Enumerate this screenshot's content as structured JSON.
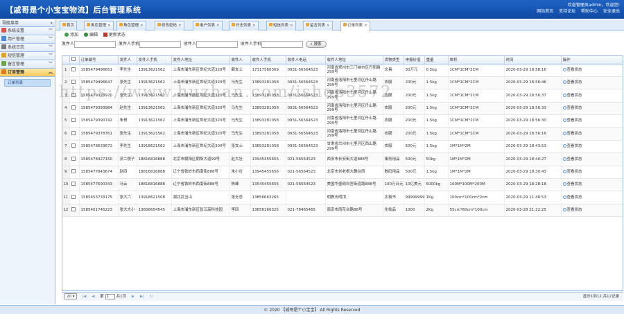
{
  "header": {
    "title": "【戚哥是个小宝宝物流】后台管理系统",
    "welcome": "欢迎管理员admin，欢迎您!",
    "links": [
      "网站首页",
      "支持论坛",
      "帮助中心",
      "安全退出"
    ]
  },
  "sidebar": {
    "title": "导航菜单",
    "collapse": "«",
    "items": [
      {
        "label": "系统设置",
        "icon_color": "#d9534f"
      },
      {
        "label": "用户管理",
        "icon_color": "#4a86d8"
      },
      {
        "label": "系统日志",
        "icon_color": "#7a7a7a"
      },
      {
        "label": "短信管理",
        "icon_color": "#e0a030"
      },
      {
        "label": "留言管理",
        "icon_color": "#6aa84f"
      },
      {
        "label": "订单管理",
        "icon_color": "#e07b20"
      }
    ],
    "sub_item": "订单列表"
  },
  "tabs": [
    {
      "label": "首页"
    },
    {
      "label": "角色管理"
    },
    {
      "label": "角色管理"
    },
    {
      "label": "修改密码"
    },
    {
      "label": "用户列表"
    },
    {
      "label": "日志列表"
    },
    {
      "label": "短信列表"
    },
    {
      "label": "留言列表"
    },
    {
      "label": "订单列表"
    }
  ],
  "tab_close": "×",
  "toolbar": {
    "add": "添加",
    "edit": "编辑",
    "status": "更新状态"
  },
  "search": {
    "sender": "发件人",
    "sender_phone": "发件人手机",
    "receiver": "收件人",
    "receiver_phone": "收件人手机",
    "button": "搜索"
  },
  "columns": [
    "订单编号",
    "发件人",
    "发件人手机",
    "发件人地址",
    "收件人",
    "收件人手机",
    "收件人电话",
    "收件人地址",
    "货物类型",
    "申报价值",
    "重量",
    "体积",
    "时间",
    "操作"
  ],
  "action_label": "查看状态",
  "rows": [
    [
      "1585479496651",
      "李先生",
      "13913621562",
      "上海市浦东新区世纪大道320号",
      "薛女士",
      "17317560369",
      "0931-56564523",
      "河南省郑州市三门峡市区丹阳路299号",
      "文具",
      "30万元",
      "0.5kg",
      "1CM*1CM*2CM",
      "2020-03-29 18:58:16"
    ],
    [
      "1585479496647",
      "张先生",
      "13913621562",
      "上海市浦东新区世纪大道320号",
      "马先生",
      "13893281058",
      "0931-56564523",
      "河南省洛阳市七里河区丹山路299号",
      "衣服",
      "200元",
      "1.5kg",
      "1CM*1CM*2CM",
      "2020-03-29 18:56:46"
    ],
    [
      "1585479393970",
      "张先生",
      "13913621562",
      "上海市浦东新区世纪大道320号",
      "马先生",
      "13893281058",
      "0931-56564523",
      "河南省洛阳市七里河区丹山路299号",
      "衣服",
      "200元",
      "1.5kg",
      "1CM*1CM*2CM",
      "2020-03-29 18:56:37"
    ],
    [
      "1585479393984",
      "赵先生",
      "13913621562",
      "上海市浦东新区世纪大道320号",
      "马先生",
      "13893281058",
      "0931-56564523",
      "河南省洛阳市七里河区丹山路299号",
      "衣服",
      "200元",
      "1.5kg",
      "1CM*1CM*2CM",
      "2020-03-29 18:56:33"
    ],
    [
      "1585479390742",
      "朱哥",
      "13913621562",
      "上海市浦东新区世纪大道320号",
      "马先生",
      "13893281058",
      "0931-56564523",
      "河南省洛阳市七里河区丹山路299号",
      "衣服",
      "200元",
      "1.5kg",
      "1CM*1CM*2CM",
      "2020-03-29 18:56:30"
    ],
    [
      "1585479378761",
      "张先生",
      "13913621562",
      "上海市浦东新区世纪大道320号",
      "马先生",
      "13893281058",
      "0931-56564523",
      "河南省洛阳市七里河区丹山路299号",
      "衣服",
      "200元",
      "1.5kg",
      "1CM*1CM*2CM",
      "2020-03-29 18:56:16"
    ],
    [
      "1585478633672",
      "李先生",
      "13918621562",
      "上海市浦东新区世纪大道300号",
      "张女士",
      "13893281058",
      "0931-56564523",
      "甘肃省兰州市七里河区西山路299号",
      "衣服",
      "500元",
      "1.5kg",
      "1M*1M*2M",
      "2020-03-29 18:43:53"
    ],
    [
      "1585478427150",
      "灵二傻子",
      "18816816888",
      "北京市朝阳区朝阳大道99号",
      "赵大壮",
      "13945455656",
      "021-56564523",
      "西安市长安街大道888号",
      "事务用品",
      "500元",
      "50kg",
      "1M*1M*2M",
      "2020-03-29 18:40:27"
    ],
    [
      "1585477843674",
      "赵四",
      "18816816888",
      "辽宁省铁岭市西南街888号",
      "朱小壮",
      "13945455656",
      "021-56564523",
      "北京市刘老根大舞台西",
      "数码用品",
      "500元",
      "1.5kg",
      "1M*1M*2M",
      "2020-03-29 18:30:43"
    ],
    [
      "1585477690343",
      "马云",
      "18816816888",
      "辽宁省铁岭市西南街888号",
      "陈峰",
      "13545455656",
      "021-56564523",
      "美国华盛顿白宫街道路888号",
      "100万日元",
      "10亿美元",
      "5000kg",
      "100M*100M*200M",
      "2020-03-29 18:28:18"
    ],
    [
      "1585453733175",
      "张大六",
      "13918621508",
      "湖北武当山",
      "张无忌",
      "13856663265",
      "",
      "明教光明顶",
      "太极书",
      "99999999",
      "1Kg",
      "100cm*100cm*2cm",
      "2020-03-29 11:48:53"
    ],
    [
      "1585401745223",
      "张大大小",
      "13656654545",
      "上海市浦东新区张江高科技园",
      "李四",
      "13656166325",
      "021-78465465",
      "南京市雨花台路88号",
      "化妆品",
      "1000",
      "2Kg",
      "55cm*60cm*100cm",
      "2020-03-28 21:22:25"
    ]
  ],
  "pager": {
    "page_size": "20",
    "page_label": "第",
    "page_value": "1",
    "total_pages": "共1页",
    "summary": "显示1到12,共12记录"
  },
  "footer": "© 2020 【戚哥是个小宝宝】 All Rights Reserved",
  "watermark": "https://www.huzhan.com/ishop3572"
}
